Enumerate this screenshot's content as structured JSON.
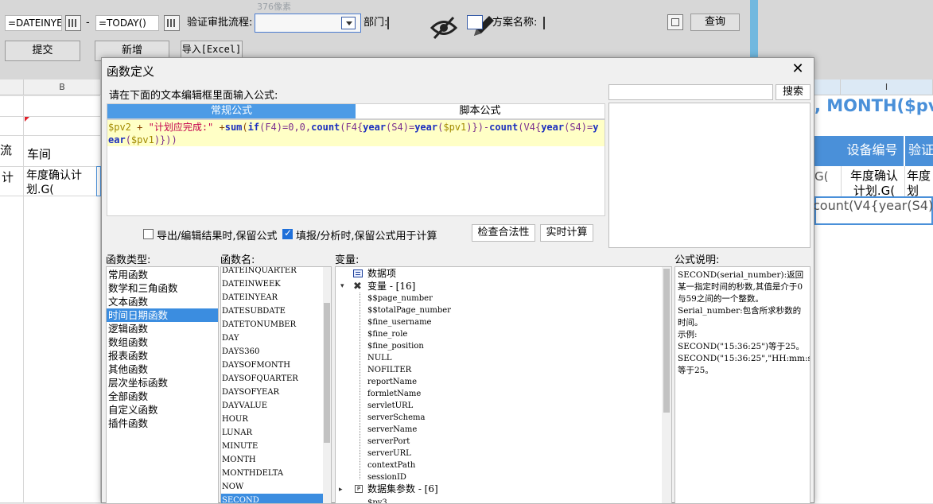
{
  "toolbar": {
    "start_date": "=DATEINYE",
    "dash": "-",
    "end_date": "=TODAY()",
    "approval_label": "验证审批流程:",
    "ruler_note": "376像素",
    "dept_label": "部门:",
    "plan_label": "方案名称:",
    "query_button": "查询",
    "submit_button": "提交",
    "add_button": "新增",
    "import_button": "导入[Excel]"
  },
  "grid": {
    "col_b": "B",
    "col_i": "I",
    "left_header_cut": "流",
    "workshop": "车间",
    "left_cell_cut": "计",
    "cell_text_b": "年度确认计划.G(",
    "formula_banner": ", MONTH($pv",
    "device_no": "设备编号",
    "verify_cut": "验证",
    "right_cell_1": "年度确认计划.G(",
    "right_cell_2": "年度划",
    "g_fragment": "G(",
    "count_fragment": "count(V4{year(S4)="
  },
  "dialog": {
    "title": "函数定义",
    "close": "✕",
    "prompt": "请在下面的文本编辑框里面输入公式:",
    "tabs": [
      "常规公式",
      "脚本公式"
    ],
    "formula_tokens": [
      {
        "t": "$pv2",
        "c": "var"
      },
      {
        "t": " + ",
        "c": "op"
      },
      {
        "t": "\"计划应完成:\"",
        "c": "str"
      },
      {
        "t": " +",
        "c": "op"
      },
      {
        "t": "sum",
        "c": "fn"
      },
      {
        "t": "(",
        "c": "op"
      },
      {
        "t": "if",
        "c": "fn"
      },
      {
        "t": "(F4)=0,0,",
        "c": "ref"
      },
      {
        "t": "count",
        "c": "fn"
      },
      {
        "t": "(F4{",
        "c": "ref"
      },
      {
        "t": "year",
        "c": "fn"
      },
      {
        "t": "(S4)=",
        "c": "ref"
      },
      {
        "t": "year",
        "c": "fn"
      },
      {
        "t": "(",
        "c": "ref"
      },
      {
        "t": "$pv1",
        "c": "var"
      },
      {
        "t": ")})-",
        "c": "ref"
      },
      {
        "t": "count",
        "c": "fn"
      },
      {
        "t": "(V4{",
        "c": "ref"
      },
      {
        "t": "year",
        "c": "fn"
      },
      {
        "t": "(S4)=",
        "c": "ref"
      },
      {
        "t": "year",
        "c": "fn"
      },
      {
        "t": "(",
        "c": "ref"
      },
      {
        "t": "$pv1",
        "c": "var"
      },
      {
        "t": ")}))",
        "c": "ref"
      }
    ],
    "search_button": "搜索",
    "keep_formula_export": "导出/编辑结果时,保留公式",
    "keep_formula_fill": "填报/分析时,保留公式用于计算",
    "check_button": "检查合法性",
    "realtime_button": "实时计算",
    "func_type_label": "函数类型:",
    "func_name_label": "函数名:",
    "var_label": "变量:",
    "desc_label": "公式说明:",
    "func_types": [
      "常用函数",
      "数学和三角函数",
      "文本函数",
      "时间日期函数",
      "逻辑函数",
      "数组函数",
      "报表函数",
      "其他函数",
      "层次坐标函数",
      "全部函数",
      "自定义函数",
      "插件函数"
    ],
    "func_names": [
      "DATEINQUARTER",
      "DATEINWEEK",
      "DATEINYEAR",
      "DATESUBDATE",
      "DATETONUMBER",
      "DAY",
      "DAYS360",
      "DAYSOFMONTH",
      "DAYSOFQUARTER",
      "DAYSOFYEAR",
      "DAYVALUE",
      "HOUR",
      "LUNAR",
      "MINUTE",
      "MONTH",
      "MONTHDELTA",
      "NOW",
      "SECOND"
    ],
    "var_root": "数据项",
    "var_group": "变量 - [16]",
    "var_items": [
      "$$page_number",
      "$$totalPage_number",
      "$fine_username",
      "$fine_role",
      "$fine_position",
      "NULL",
      "NOFILTER",
      "reportName",
      "formletName",
      "servletURL",
      "serverSchema",
      "serverName",
      "serverPort",
      "serverURL",
      "contextPath",
      "sessionID"
    ],
    "var_group2": "数据集参数 - [6]",
    "var_group2_first": "$pv3",
    "description": [
      "SECOND(serial_number):返回某一指定时间的秒数,其值是介于0与59之间的一个整数。",
      "Serial_number:包含所求秒数的时间。",
      "示例:",
      "SECOND(\"15:36:25\")等于25。",
      "SECOND(\"15:36:25\",\"HH:mm:ss\")等于25。"
    ]
  }
}
